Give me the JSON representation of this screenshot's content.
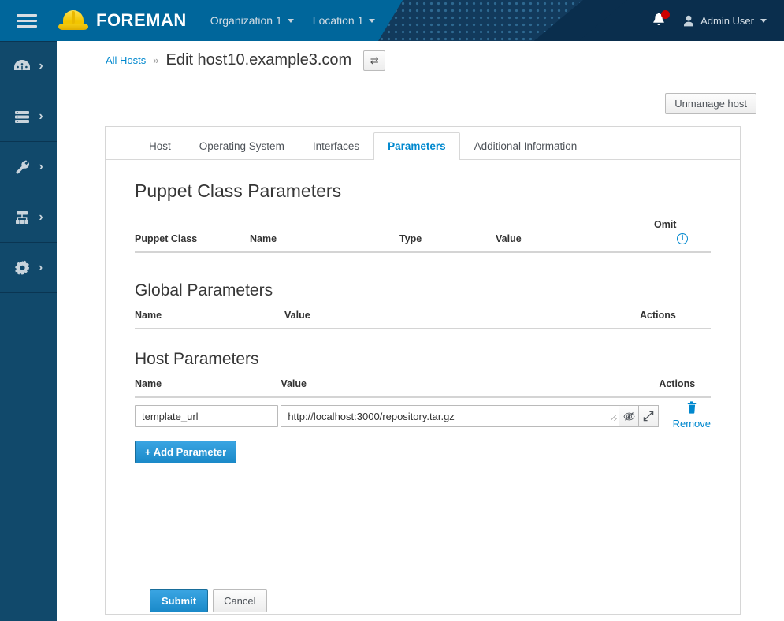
{
  "masthead": {
    "menu_icon": "hamburger-icon",
    "logo_icon": "hardhat-icon",
    "brand": "FOREMAN",
    "organization": "Organization 1",
    "location": "Location 1",
    "notifications_icon": "bell-icon",
    "user_icon": "user-avatar-icon",
    "user": "Admin User",
    "colors": {
      "teal": "#00669b",
      "navy": "#0a2e4d",
      "badge": "#cc0000"
    }
  },
  "sidebar": {
    "items": [
      {
        "icon": "dashboard-gauge-icon",
        "name": "monitor"
      },
      {
        "icon": "server-stack-icon",
        "name": "hosts"
      },
      {
        "icon": "wrench-icon",
        "name": "configure"
      },
      {
        "icon": "sitemap-icon",
        "name": "infrastructure"
      },
      {
        "icon": "gear-icon",
        "name": "administer"
      }
    ],
    "chevron": "›"
  },
  "breadcrumb": {
    "root_label": "All Hosts",
    "separator": "»",
    "title": "Edit host10.example3.com",
    "switcher_icon": "⇄"
  },
  "toolbar": {
    "unmanage_label": "Unmanage host"
  },
  "tabs": [
    {
      "label": "Host",
      "active": false
    },
    {
      "label": "Operating System",
      "active": false
    },
    {
      "label": "Interfaces",
      "active": false
    },
    {
      "label": "Parameters",
      "active": true
    },
    {
      "label": "Additional Information",
      "active": false
    }
  ],
  "puppet_section": {
    "title": "Puppet Class Parameters",
    "headers": {
      "puppet_class": "Puppet Class",
      "name": "Name",
      "type": "Type",
      "value": "Value",
      "omit": "Omit",
      "omit_info_icon": "info-circle-icon"
    },
    "rows": []
  },
  "global_section": {
    "title": "Global Parameters",
    "headers": {
      "name": "Name",
      "value": "Value",
      "actions": "Actions"
    },
    "rows": []
  },
  "host_section": {
    "title": "Host Parameters",
    "headers": {
      "name": "Name",
      "value": "Value",
      "actions": "Actions"
    },
    "rows": [
      {
        "name": "template_url",
        "name_placeholder": "",
        "value": "http://localhost:3000/repository.tar.gz",
        "value_placeholder": "",
        "hide_icon": "eye-slash-icon",
        "expand_icon": "expand-arrows-icon",
        "remove_icon": "trash-icon",
        "remove_label": "Remove"
      }
    ],
    "add_label": "+ Add Parameter"
  },
  "footer": {
    "submit_label": "Submit",
    "cancel_label": "Cancel"
  }
}
